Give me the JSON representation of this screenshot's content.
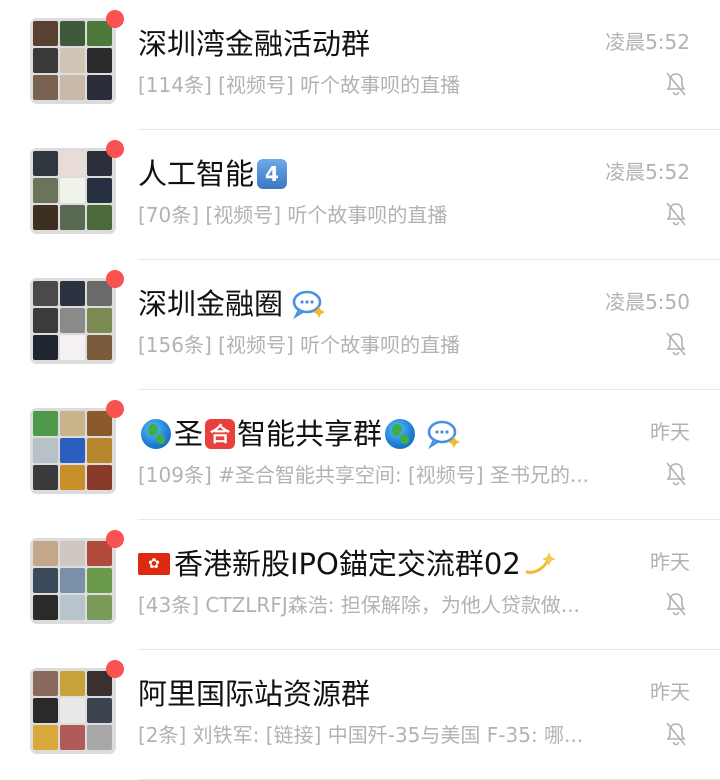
{
  "chats": [
    {
      "title": "深圳湾金融活动群",
      "time": "凌晨5:52",
      "preview": "[114条] [视频号] 听个故事呗的直播",
      "unread_dot": true,
      "muted": true,
      "avatar_colors": [
        "#5a4030",
        "#3e5a3a",
        "#4d7a3a",
        "#3a3a3a",
        "#cfc6b6",
        "#2b2b2b",
        "#7a6250",
        "#c9b9a8",
        "#2a2d3a"
      ]
    },
    {
      "title": "人工智能",
      "title_badge": "4",
      "time": "凌晨5:52",
      "preview": "[70条] [视频号] 听个故事呗的直播",
      "unread_dot": true,
      "muted": true,
      "avatar_colors": [
        "#2f3640",
        "#e8ddd6",
        "#2c2f3a",
        "#6a7458",
        "#f0f3e8",
        "#263040",
        "#3d3020",
        "#5a6a52",
        "#4a6a3a"
      ]
    },
    {
      "title": "深圳金融圈",
      "time": "凌晨5:50",
      "preview": "[156条] [视频号] 听个故事呗的直播",
      "unread_dot": true,
      "muted": true,
      "avatar_colors": [
        "#4a4a4a",
        "#2c3240",
        "#6a6a6a",
        "#3c3c3c",
        "#8a8a8a",
        "#7a8a52",
        "#1e2430",
        "#f4f0f4",
        "#7a5a3a"
      ]
    },
    {
      "title": "圣合智能共享群",
      "title_emoji_box": "合",
      "time": "昨天",
      "preview": "[109条] #圣合智能共享空间: [视频号] 圣书兄的...",
      "unread_dot": true,
      "muted": true,
      "avatar_colors": [
        "#4f9a4a",
        "#c8b48a",
        "#8a5a2a",
        "#b8c0c8",
        "#2a5fbf",
        "#b8862a",
        "#3a3a3a",
        "#c9902a",
        "#8a3a2a"
      ]
    },
    {
      "title": "香港新股IPO錨定交流群02",
      "time": "昨天",
      "preview": "[43条] CTZLRFJ森浩: 担保解除，为他人贷款做...",
      "unread_dot": true,
      "muted": true,
      "avatar_colors": [
        "#c4a68a",
        "#d0c8c0",
        "#b04a3a",
        "#3a4a5a",
        "#7a8fa8",
        "#6a9a4a",
        "#2a2a2a",
        "#b8c4cc",
        "#7a9a5a"
      ]
    },
    {
      "title": "阿里国际站资源群",
      "time": "昨天",
      "preview": "[2条] 刘铁军: [链接] 中国歼-35与美国 F-35: 哪...",
      "unread_dot": true,
      "muted": true,
      "avatar_colors": [
        "#8a6a5a",
        "#c9a23a",
        "#3a3030",
        "#2a2a2a",
        "#e8e8e8",
        "#3c4450",
        "#d8a83a",
        "#b05a5a",
        "#a8a8a8"
      ]
    }
  ],
  "colors": {
    "unread": "#fa5151",
    "secondary_text": "#b2b2b2",
    "title_text": "#111111",
    "divider": "#e8e8e8"
  },
  "icons": {
    "mute": "bell-slash-icon",
    "chat_bubble": "chat-bubble-icon",
    "globe": "globe-icon",
    "hk_flag": "hong-kong-flag-icon",
    "sparkle": "dizzy-sparkle-icon"
  }
}
